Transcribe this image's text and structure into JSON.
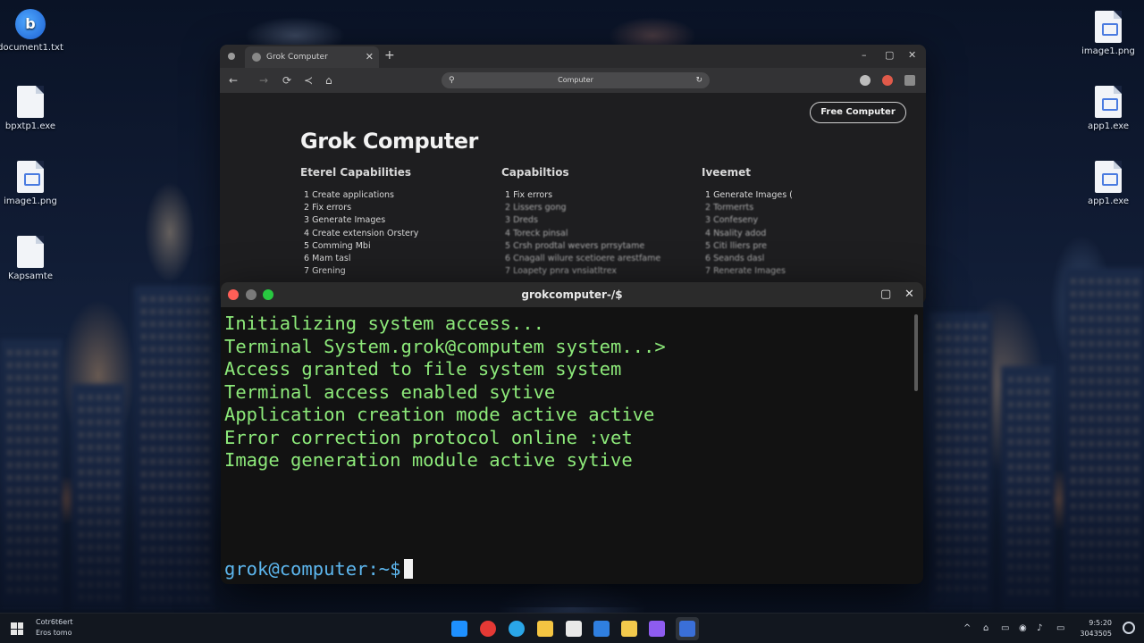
{
  "desktop": {
    "icons_left": [
      {
        "label": "document1.txt",
        "icon": "blue-app-icon"
      },
      {
        "label": "bpxtp1.exe",
        "icon": "file-icon"
      },
      {
        "label": "image1.png",
        "icon": "image-file-icon"
      },
      {
        "label": "Kapsamte",
        "icon": "file-icon"
      }
    ],
    "icons_right": [
      {
        "label": "image1.png",
        "icon": "image-file-icon"
      },
      {
        "label": "app1.exe",
        "icon": "image-file-icon"
      },
      {
        "label": "app1.exe",
        "icon": "image-file-icon"
      }
    ]
  },
  "browser": {
    "tab_label": "Grok Computer",
    "tab_close": "✕",
    "new_tab": "+",
    "address": "Computer",
    "controls": {
      "minimize": "–",
      "maximize": "▢",
      "close": "✕"
    },
    "nav": {
      "back": "←",
      "forward": "→",
      "reload": "⟳",
      "extra": "≺",
      "home": "⌂"
    },
    "page": {
      "cta_label": "Free Computer",
      "title": "Grok Computer",
      "columns": [
        {
          "heading": "Eterel Capabilities",
          "items": [
            "1 Create applications",
            "2 Fix errors",
            "3 Generate Images",
            "4 Create extension Orstery",
            "5 Comming Mbi",
            "6 Mam tasl",
            "7 Grening"
          ]
        },
        {
          "heading": "Capabiltios",
          "items": [
            "1 Fix errors",
            "2 Lissers gong",
            "3 Dreds",
            "4 Toreck pinsal",
            "5 Crsh prodtal wevers prrsytame",
            "6 Cnagall wilure scetioere arestfame",
            "7 Loapety pnra vnsiatltrex"
          ]
        },
        {
          "heading": "Iveemet",
          "items": [
            "1 Generate Images (",
            "2 Tormerrts",
            "3 Confeseny",
            "4 Nsality adod",
            "5 Citi lliers pre",
            "6 Seands dasl",
            "7 Renerate Images"
          ]
        }
      ]
    }
  },
  "terminal": {
    "title": "grokcomputer-/$",
    "controls": {
      "maximize": "▢",
      "close": "✕"
    },
    "lines": [
      "Initializing system access...",
      "Terminal System.grok@computem system...>",
      "Access granted to file system system",
      "Terminal access enabled sytive",
      "Application creation mode active active",
      "Error correction protocol online :vet",
      "Image generation module active sytive"
    ],
    "prompt": "grok@computer:~$"
  },
  "taskbar": {
    "left_text": [
      "Cotr6t6ert",
      "Eros tomo"
    ],
    "clock": [
      "9:5:20",
      "3043505"
    ],
    "apps": [
      {
        "name": "terminal-app-icon",
        "color": "#1e90ff"
      },
      {
        "name": "red-app-icon",
        "color": "#e53935"
      },
      {
        "name": "edge-browser-icon",
        "color": "#2aa6e8"
      },
      {
        "name": "file-explorer-icon",
        "color": "#f5c542"
      },
      {
        "name": "notepad-icon",
        "color": "#e8e8e8"
      },
      {
        "name": "store-icon",
        "color": "#2f7fe0"
      },
      {
        "name": "folder-icon",
        "color": "#f2c94c"
      },
      {
        "name": "purple-app-icon",
        "color": "#8e5cf0"
      },
      {
        "name": "active-terminal-icon",
        "color": "#3a6fd8"
      }
    ],
    "tray_icons": [
      "^",
      "⌂",
      "▭",
      "◉",
      "♪",
      "▭"
    ]
  }
}
